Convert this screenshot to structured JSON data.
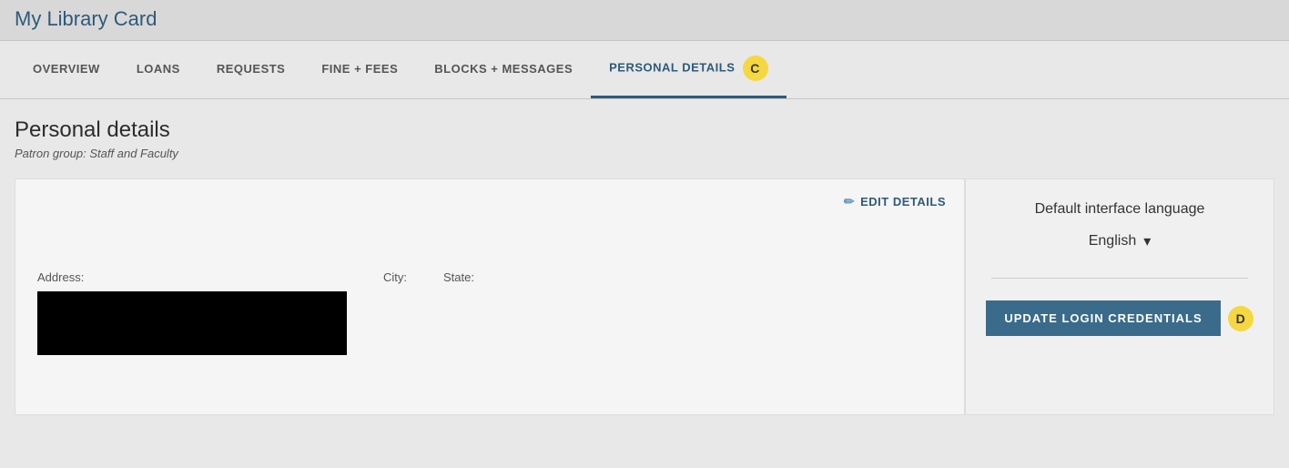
{
  "header": {
    "title": "My Library Card"
  },
  "tabs": [
    {
      "id": "overview",
      "label": "OVERVIEW",
      "active": false
    },
    {
      "id": "loans",
      "label": "LOANS",
      "active": false
    },
    {
      "id": "requests",
      "label": "REQUESTS",
      "active": false
    },
    {
      "id": "fine-fees",
      "label": "FINE + FEES",
      "active": false
    },
    {
      "id": "blocks-messages",
      "label": "BLOCKS + MESSAGES",
      "active": false
    },
    {
      "id": "personal-details",
      "label": "PERSONAL DETAILS",
      "active": true
    }
  ],
  "tab_annotation": "C",
  "page": {
    "title": "Personal details",
    "patron_group_label": "Patron group: Staff and Faculty"
  },
  "details_card": {
    "edit_button_label": "EDIT DETAILS",
    "address_label": "Address:",
    "city_label": "City:",
    "state_label": "State:"
  },
  "right_panel": {
    "language_label": "Default interface language",
    "language_value": "English",
    "update_button_label": "UPDATE LOGIN CREDENTIALS",
    "btn_annotation": "D"
  }
}
